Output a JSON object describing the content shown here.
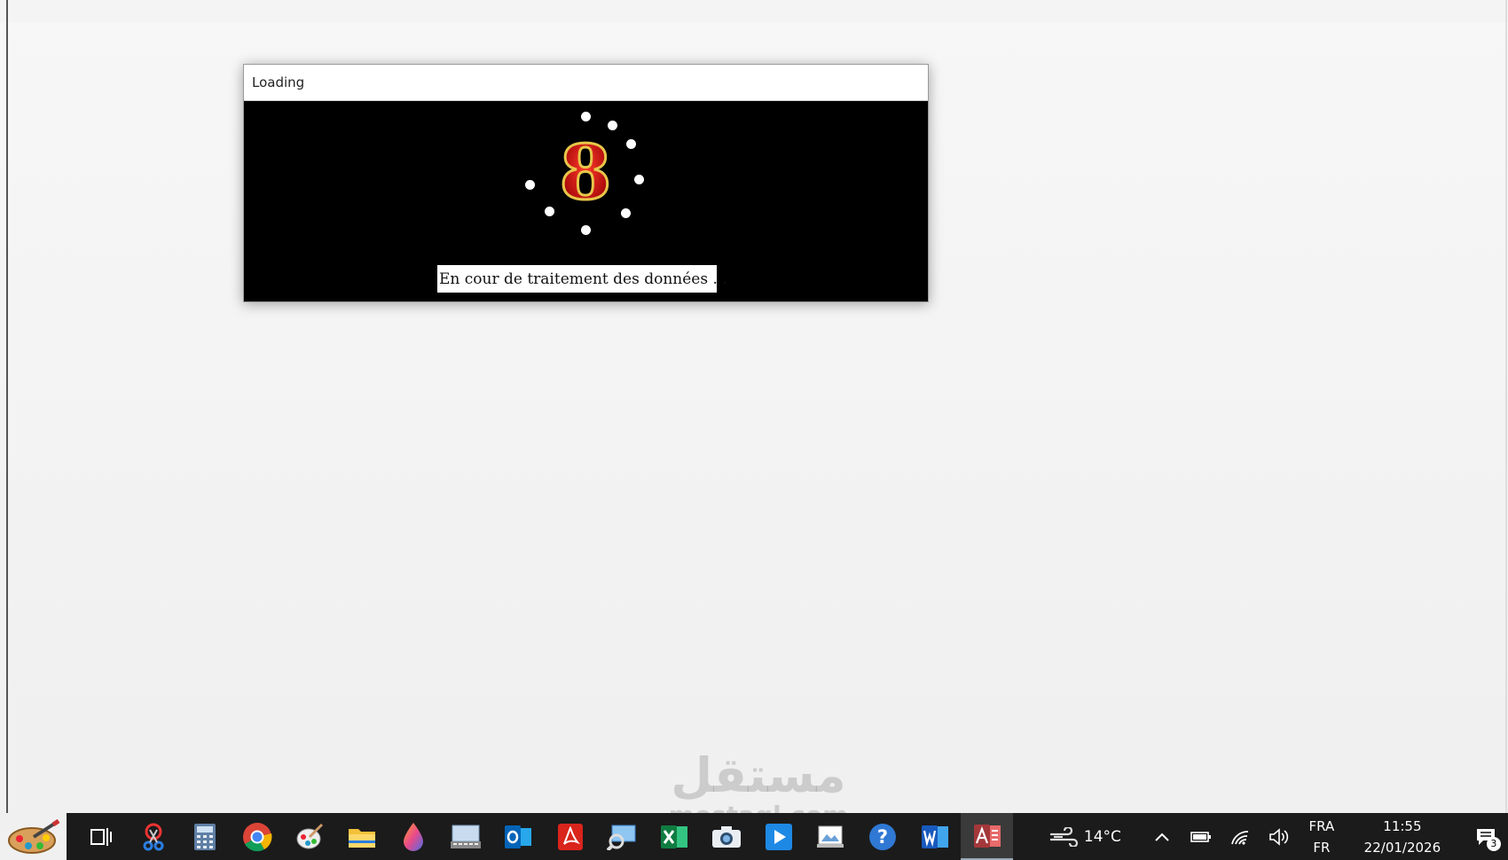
{
  "dialog": {
    "title": "Loading",
    "status_text": "En cour de traitement des données  . ."
  },
  "spinner": {
    "center_glyph": "8"
  },
  "watermark": {
    "arabic": "مستقل",
    "latin": "mostaql.com"
  },
  "taskbar": {
    "pinned_apps": [
      {
        "name": "task-view-icon"
      },
      {
        "name": "snipping-tool-icon"
      },
      {
        "name": "calculator-icon"
      },
      {
        "name": "chrome-icon"
      },
      {
        "name": "paint-3d-icon"
      },
      {
        "name": "file-explorer-icon"
      },
      {
        "name": "paint-drop-icon"
      },
      {
        "name": "on-screen-keyboard-icon"
      },
      {
        "name": "outlook-icon"
      },
      {
        "name": "acrobat-reader-icon"
      },
      {
        "name": "remote-desktop-icon"
      },
      {
        "name": "excel-icon"
      },
      {
        "name": "camera-icon"
      },
      {
        "name": "media-player-icon"
      },
      {
        "name": "photo-viewer-icon"
      },
      {
        "name": "help-icon"
      },
      {
        "name": "word-icon"
      },
      {
        "name": "access-icon"
      }
    ],
    "weather": {
      "temperature": "14°C"
    },
    "language": {
      "line1": "FRA",
      "line2": "FR"
    },
    "clock": {
      "time": "11:55",
      "date": "22/01/2026"
    },
    "notifications": {
      "count": "3"
    }
  }
}
